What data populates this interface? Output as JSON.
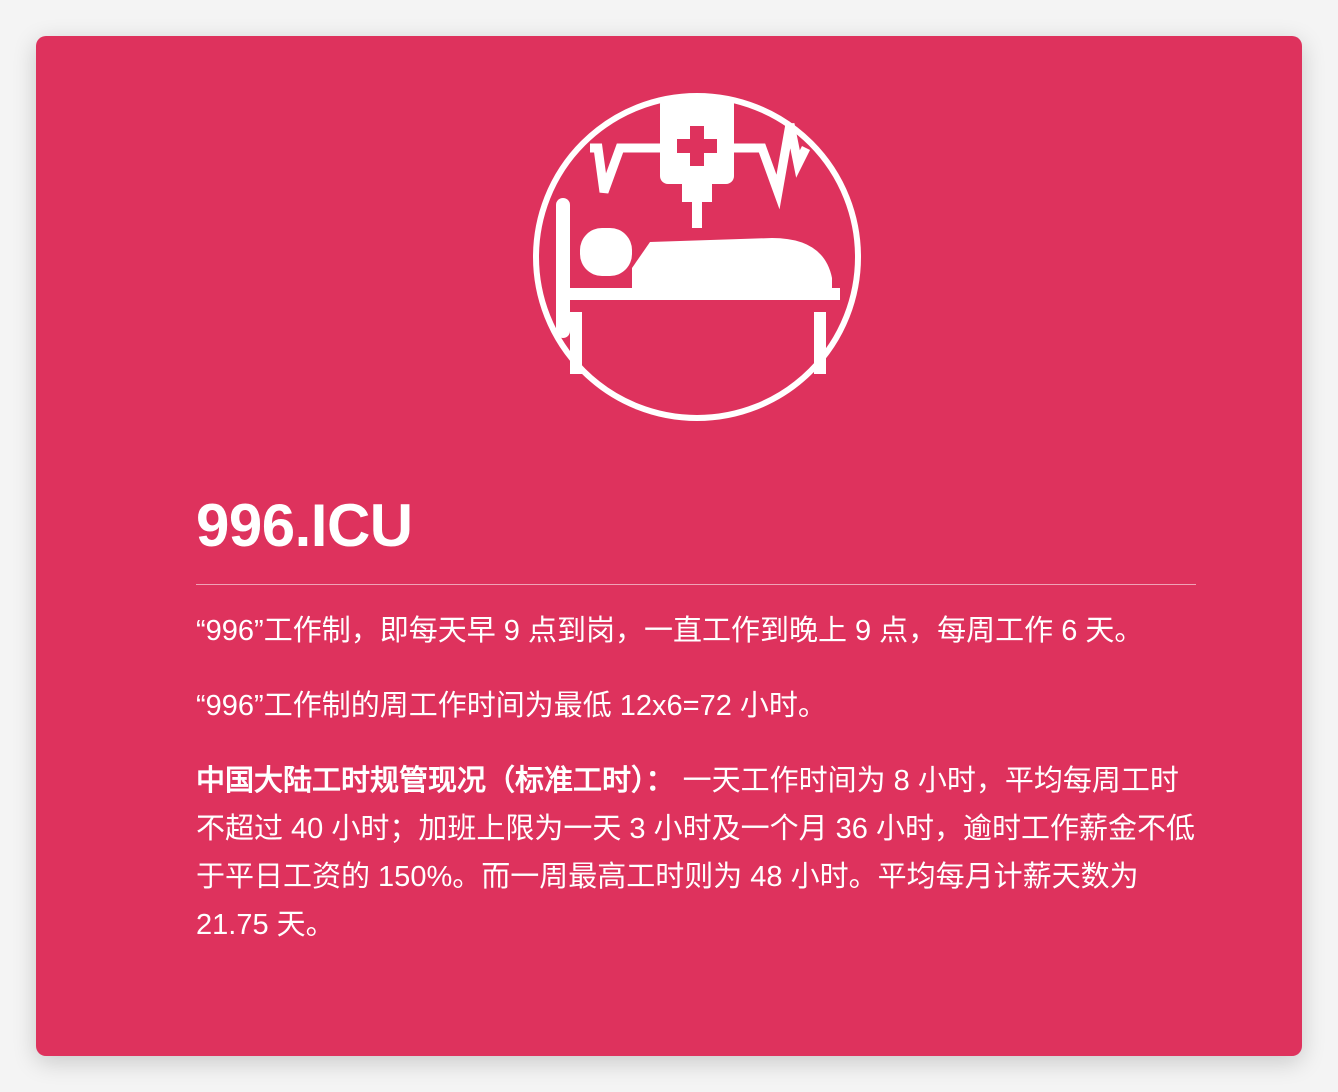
{
  "brand": {
    "accent_color": "#de325d",
    "foreground_color": "#ffffff",
    "logo_icon": "hospital-bed-iv-drip-icon"
  },
  "site": {
    "title": "996.ICU"
  },
  "paragraphs": {
    "p1": "“996”工作制，即每天早 9 点到岗，一直工作到晚上 9 点，每周工作 6 天。",
    "p2": "“996”工作制的周工作时间为最低 12x6=72 小时。",
    "p3_heading": "中国大陆工时规管现况（标准工时）：",
    "p3_body": " 一天工作时间为 8 小时，平均每周工时不超过 40 小时；加班上限为一天 3 小时及一个月 36 小时，逾时工作薪金不低于平日工资的 150%。而一周最高工时则为 48 小时。平均每月计薪天数为 21.75 天。"
  }
}
